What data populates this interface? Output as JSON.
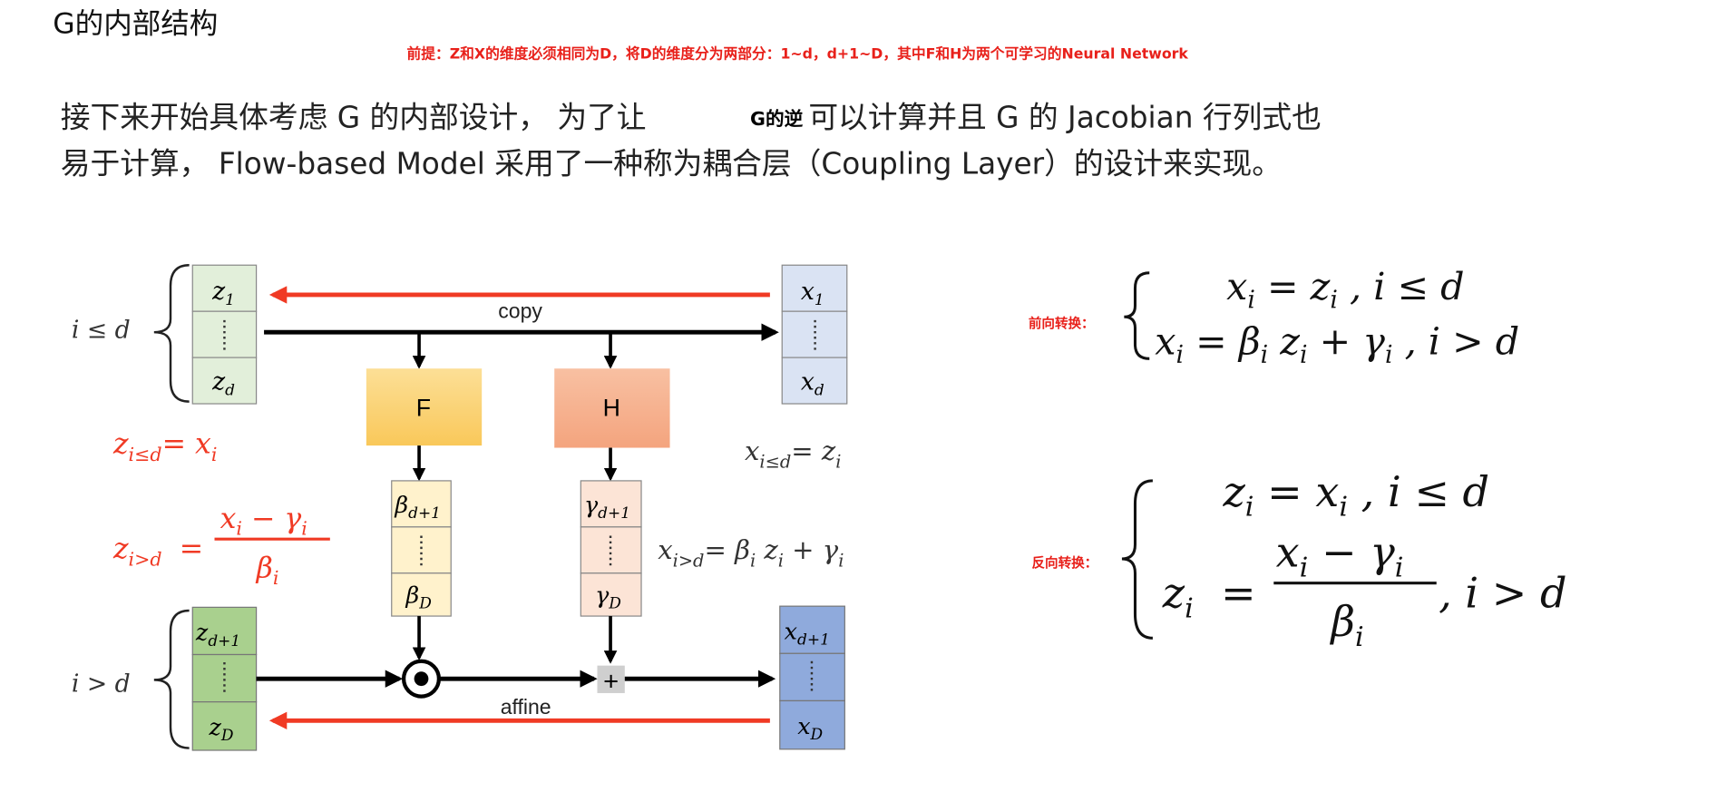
{
  "title": "G的内部结构",
  "premise": "前提：Z和X的维度必须相同为D，将D的维度分为两部分：1~d，d+1~D，其中F和H为两个可学习的Neural Network",
  "paragraph": {
    "line1_a": "接下来开始具体考虑 G 的内部设计， 为了让",
    "overlay": "G的逆",
    "line1_b": "可以计算并且 G 的 Jacobian 行列式也",
    "line2": "易于计算， Flow-based Model 采用了一种称为耦合层（Coupling Layer）的设计来实现。"
  },
  "diagram": {
    "label_top": "i ≤ d",
    "label_bottom": "i > d",
    "copy": "copy",
    "affine": "affine",
    "F": "F",
    "H": "H",
    "z_top": [
      "z",
      "1",
      "z",
      "d"
    ],
    "x_top": [
      "x",
      "1",
      "x",
      "d"
    ],
    "z_bottom": [
      "z",
      "d+1",
      "z",
      "D"
    ],
    "x_bottom": [
      "x",
      "d+1",
      "x",
      "D"
    ],
    "beta": [
      "β",
      "d+1",
      "β",
      "D"
    ],
    "gamma": [
      "γ",
      "d+1",
      "γ",
      "D"
    ],
    "plus": "+",
    "eq_red_1": {
      "lhs": "z",
      "sub": "i≤d",
      "rhs": "= x",
      "rsub": "i"
    },
    "eq_red_2": {
      "lhs": "z",
      "sub": "i>d",
      "eq": "=",
      "num": "x",
      "num_sub": "i",
      "num_mid": " − γ",
      "num_sub2": "i",
      "den": "β",
      "den_sub": "i"
    },
    "eq_black_1": {
      "lhs": "x",
      "sub": "i≤d",
      "rhs": "= z",
      "rsub": "i"
    },
    "eq_black_2": {
      "lhs": "x",
      "sub": "i>d",
      "rhs": "= β",
      "rsub": "i",
      "mid": " z",
      "msub": "i",
      "tail": " + γ",
      "tsub": "i"
    }
  },
  "forward": {
    "label": "前向转换：",
    "line1": {
      "a": "x",
      "as": "i",
      "b": " = z",
      "bs": "i",
      "c": " , i ≤ d"
    },
    "line2": {
      "a": "x",
      "as": "i",
      "b": " = β",
      "bs": "i",
      "c": " z",
      "cs": "i",
      "d": " + γ",
      "ds": "i",
      "e": " , i > d"
    }
  },
  "inverse": {
    "label": "反向转换：",
    "line1": {
      "a": "z",
      "as": "i",
      "b": " = x",
      "bs": "i",
      "c": " , i ≤ d"
    },
    "line2": {
      "a": "z",
      "as": "i",
      "eq": "=",
      "num": "x",
      "num_sub": "i",
      "num_mid": " − γ",
      "num_sub2": "i",
      "den": "β",
      "den_sub": "i",
      "tail": ", i > d"
    }
  },
  "colors": {
    "red": "#e8201a",
    "arrow_red": "#f03a24"
  }
}
